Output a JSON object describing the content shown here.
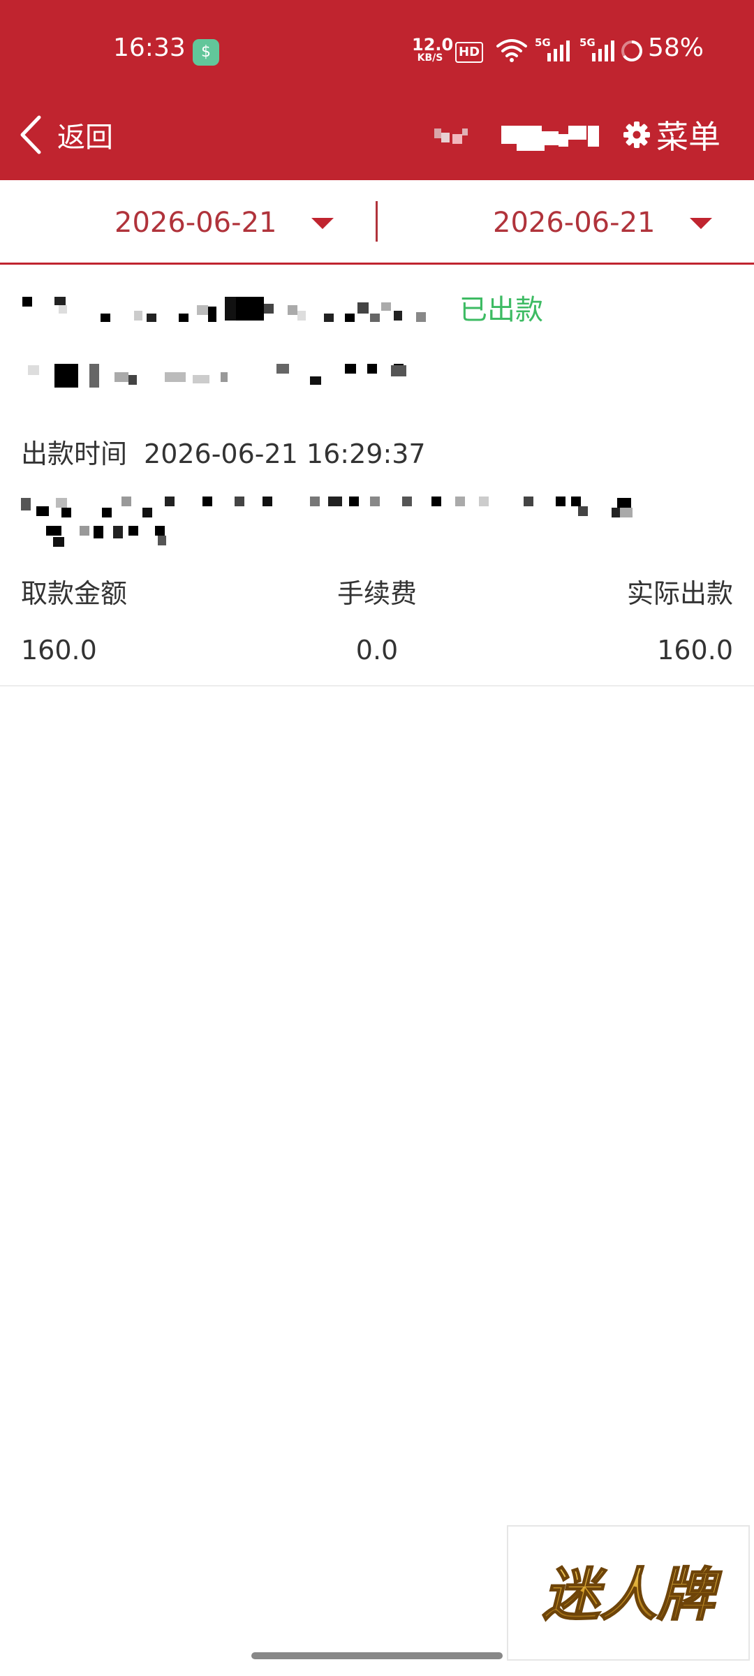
{
  "status_bar": {
    "time": "16:33",
    "net_speed_value": "12.0",
    "net_speed_unit": "KB/S",
    "hd_label": "HD",
    "signal1_label": "5G",
    "signal2_label": "5G",
    "battery": "58%"
  },
  "navbar": {
    "back_label": "返回",
    "menu_label": "菜单"
  },
  "date_filter": {
    "start_date": "2026-06-21",
    "end_date": "2026-06-21"
  },
  "record": {
    "status": "已出款",
    "payout_time_label": "出款时间",
    "payout_time_value": "2026-06-21 16:29:37",
    "columns": {
      "withdraw_amount_label": "取款金额",
      "fee_label": "手续费",
      "actual_payout_label": "实际出款"
    },
    "values": {
      "withdraw_amount": "160.0",
      "fee": "0.0",
      "actual_payout": "160.0"
    }
  },
  "brand": {
    "logo_text": "迷人牌"
  },
  "colors": {
    "header_bg": "#c0242f",
    "date_text": "#b0333b",
    "status_text": "#3dbb63",
    "body_text": "#333333"
  },
  "icons": {
    "back": "chevron-left-icon",
    "menu": "gear-icon",
    "date_dropdown": "caret-down-icon"
  }
}
